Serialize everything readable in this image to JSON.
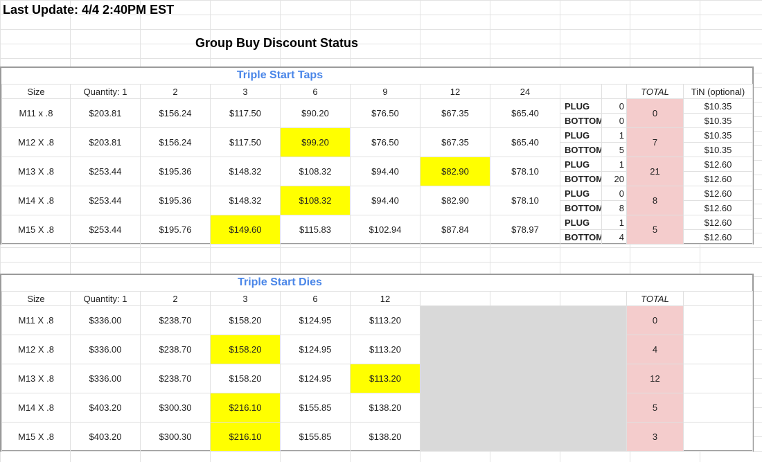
{
  "header": {
    "last_update": "Last Update: 4/4 2:40PM EST",
    "title": "Group Buy Discount Status"
  },
  "taps": {
    "title": "Triple Start Taps",
    "headers": [
      "Size",
      "Quantity: 1",
      "2",
      "3",
      "6",
      "9",
      "12",
      "24"
    ],
    "total_label": "TOTAL",
    "tin_label": "TiN (optional)",
    "plug_label": "PLUG",
    "bottom_label": "BOTTOM",
    "rows": [
      {
        "size": "M11 x .8",
        "prices": [
          "$203.81",
          "$156.24",
          "$117.50",
          "$90.20",
          "$76.50",
          "$67.35",
          "$65.40"
        ],
        "plug": "0",
        "bottom": "0",
        "total": "0",
        "tin_plug": "$10.35",
        "tin_bottom": "$10.35"
      },
      {
        "size": "M12 X .8",
        "prices": [
          "$203.81",
          "$156.24",
          "$117.50",
          "$99.20",
          "$76.50",
          "$67.35",
          "$65.40"
        ],
        "plug": "1",
        "bottom": "5",
        "total": "7",
        "tin_plug": "$10.35",
        "tin_bottom": "$10.35"
      },
      {
        "size": "M13 X .8",
        "prices": [
          "$253.44",
          "$195.36",
          "$148.32",
          "$108.32",
          "$94.40",
          "$82.90",
          "$78.10"
        ],
        "plug": "1",
        "bottom": "20",
        "total": "21",
        "tin_plug": "$12.60",
        "tin_bottom": "$12.60"
      },
      {
        "size": "M14 X .8",
        "prices": [
          "$253.44",
          "$195.36",
          "$148.32",
          "$108.32",
          "$94.40",
          "$82.90",
          "$78.10"
        ],
        "plug": "0",
        "bottom": "8",
        "total": "8",
        "tin_plug": "$12.60",
        "tin_bottom": "$12.60"
      },
      {
        "size": "M15 X .8",
        "prices": [
          "$253.44",
          "$195.76",
          "$149.60",
          "$115.83",
          "$102.94",
          "$87.84",
          "$78.97"
        ],
        "plug": "1",
        "bottom": "4",
        "total": "5",
        "tin_plug": "$12.60",
        "tin_bottom": "$12.60"
      }
    ]
  },
  "dies": {
    "title": "Triple Start Dies",
    "headers": [
      "Size",
      "Quantity: 1",
      "2",
      "3",
      "6",
      "12"
    ],
    "total_label": "TOTAL",
    "rows": [
      {
        "size": "M11 X .8",
        "prices": [
          "$336.00",
          "$238.70",
          "$158.20",
          "$124.95",
          "$113.20"
        ],
        "total": "0"
      },
      {
        "size": "M12 X .8",
        "prices": [
          "$336.00",
          "$238.70",
          "$158.20",
          "$124.95",
          "$113.20"
        ],
        "total": "4"
      },
      {
        "size": "M13 X .8",
        "prices": [
          "$336.00",
          "$238.70",
          "$158.20",
          "$124.95",
          "$113.20"
        ],
        "total": "12"
      },
      {
        "size": "M14 X .8",
        "prices": [
          "$403.20",
          "$300.30",
          "$216.10",
          "$155.85",
          "$138.20"
        ],
        "total": "5"
      },
      {
        "size": "M15 X .8",
        "prices": [
          "$403.20",
          "$300.30",
          "$216.10",
          "$155.85",
          "$138.20"
        ],
        "total": "3"
      }
    ]
  },
  "colors": {
    "highlight": "#ffff00",
    "total_fill": "#f4cccc",
    "accent": "#4a86e8",
    "plug_text": "#e00000"
  }
}
